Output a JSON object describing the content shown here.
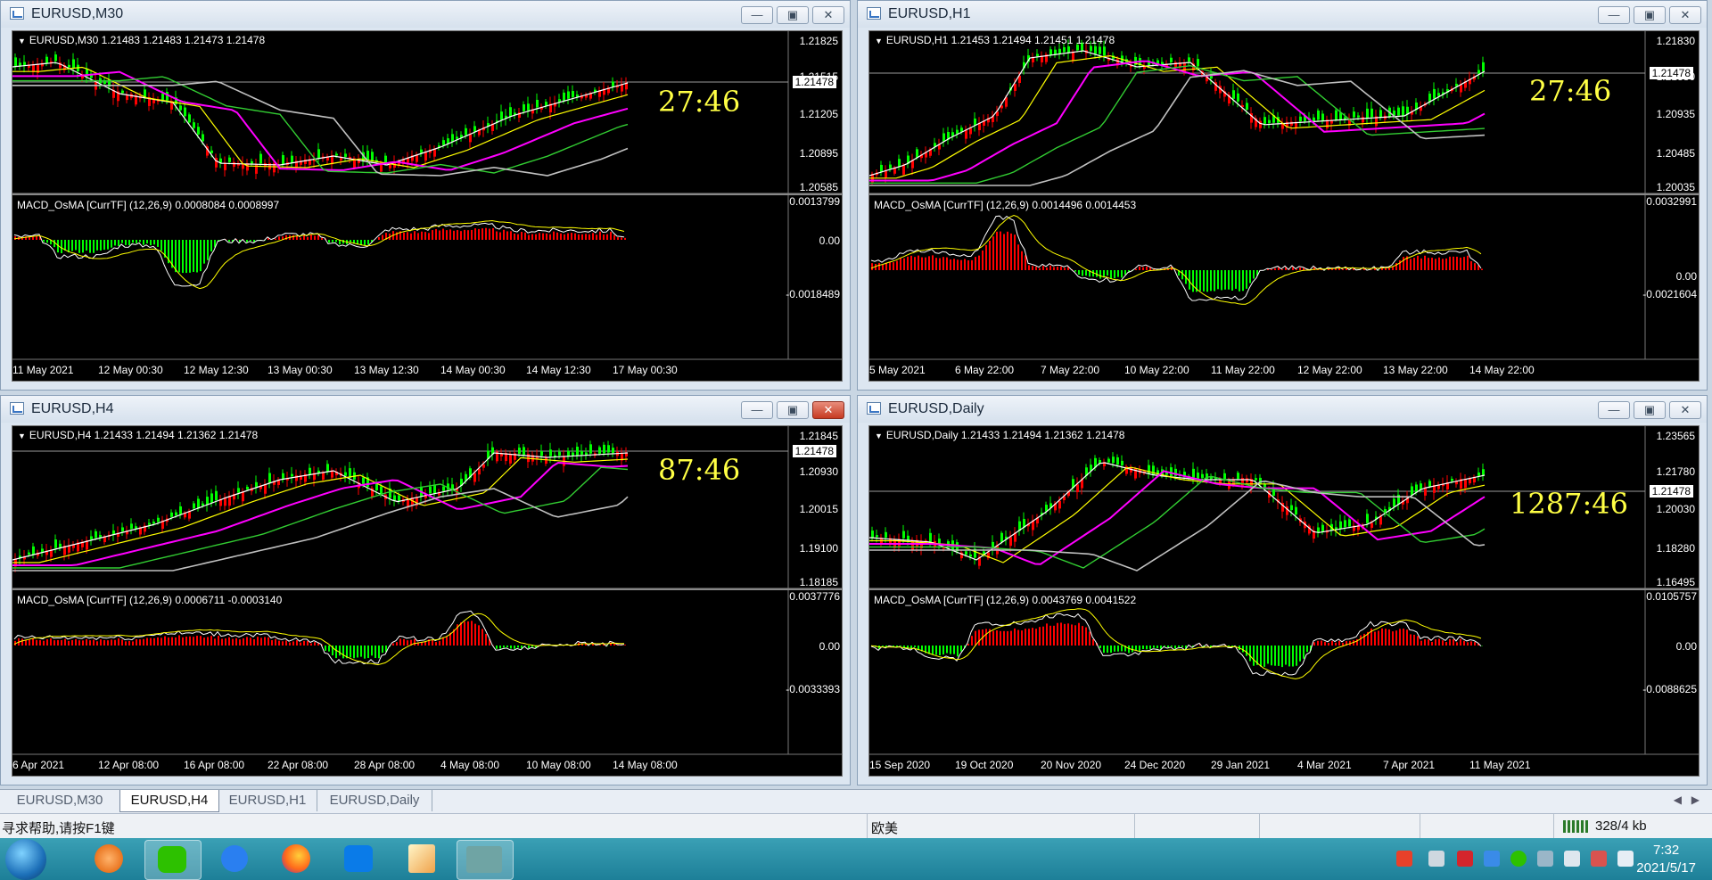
{
  "windows": [
    {
      "title": "EURUSD,M30",
      "info": "EURUSD,M30  1.21483 1.21483 1.21473 1.21478",
      "timer": "27:46",
      "price_labels": [
        "1.21825",
        "1.21515",
        "1.21205",
        "1.20895",
        "1.20585"
      ],
      "current_price": "1.21478",
      "sub_info": "MACD_OsMA [CurrTF] (12,26,9) 0.0008084 0.0008997",
      "sub_labels": [
        "0.0013799",
        "0.00",
        "-0.0018489"
      ],
      "x_labels": [
        "11 May 2021",
        "12 May 00:30",
        "12 May 12:30",
        "13 May 00:30",
        "13 May 12:30",
        "14 May 00:30",
        "14 May 12:30",
        "17 May 00:30"
      ],
      "minimize": "—",
      "maximize": "▣",
      "close": "✕"
    },
    {
      "title": "EURUSD,H1",
      "info": "EURUSD,H1  1.21453 1.21494 1.21451 1.21478",
      "timer": "27:46",
      "price_labels": [
        "1.21830",
        "1.21380",
        "1.20935",
        "1.20485",
        "1.20035"
      ],
      "current_price": "1.21478",
      "sub_info": "MACD_OsMA [CurrTF] (12,26,9) 0.0014496 0.0014453",
      "sub_labels": [
        "0.0032991",
        "0.00",
        "-0.0021604"
      ],
      "x_labels": [
        "5 May 2021",
        "6 May 22:00",
        "7 May 22:00",
        "10 May 22:00",
        "11 May 22:00",
        "12 May 22:00",
        "13 May 22:00",
        "14 May 22:00"
      ],
      "minimize": "—",
      "maximize": "▣",
      "close": "✕"
    },
    {
      "title": "EURUSD,H4",
      "info": "EURUSD,H4  1.21433 1.21494 1.21362 1.21478",
      "timer": "87:46",
      "price_labels": [
        "1.21845",
        "1.20930",
        "1.20015",
        "1.19100",
        "1.18185"
      ],
      "current_price": "1.21478",
      "sub_info": "MACD_OsMA [CurrTF] (12,26,9) 0.0006711 -0.0003140",
      "sub_labels": [
        "0.0037776",
        "0.00",
        "-0.0033393"
      ],
      "x_labels": [
        "6 Apr 2021",
        "12 Apr 08:00",
        "16 Apr 08:00",
        "22 Apr 08:00",
        "28 Apr 08:00",
        "4 May 08:00",
        "10 May 08:00",
        "14 May 08:00"
      ],
      "minimize": "—",
      "maximize": "▣",
      "close": "✕"
    },
    {
      "title": "EURUSD,Daily",
      "info": "EURUSD,Daily  1.21433 1.21494 1.21362 1.21478",
      "timer": "1287:46",
      "price_labels": [
        "1.23565",
        "1.21780",
        "1.20030",
        "1.18280",
        "1.16495"
      ],
      "current_price": "1.21478",
      "sub_info": "MACD_OsMA [CurrTF] (12,26,9) 0.0043769 0.0041522",
      "sub_labels": [
        "0.0105757",
        "0.00",
        "-0.0088625"
      ],
      "x_labels": [
        "15 Sep 2020",
        "19 Oct 2020",
        "20 Nov 2020",
        "24 Dec 2020",
        "29 Jan 2021",
        "4 Mar 2021",
        "7 Apr 2021",
        "11 May 2021"
      ],
      "minimize": "—",
      "maximize": "▣",
      "close": "✕"
    }
  ],
  "tabs": [
    "EURUSD,M30",
    "EURUSD,H4",
    "EURUSD,H1",
    "EURUSD,Daily"
  ],
  "active_tab": 1,
  "status": {
    "help_text": "寻求帮助,请按F1键",
    "profile": "欧美",
    "traffic": "328/4 kb"
  },
  "taskbar": {
    "time": "7:32",
    "date": "2021/5/17"
  },
  "colors": {
    "bull_candle": "#00ff00",
    "bear_candle": "#ff0000",
    "ma_white": "#ffffff",
    "ma_yellow": "#ffff00",
    "ma_magenta": "#ff00ff",
    "ma_green": "#32cd32",
    "ma_gray": "#c0c0c0",
    "timer": "#ffff44"
  }
}
